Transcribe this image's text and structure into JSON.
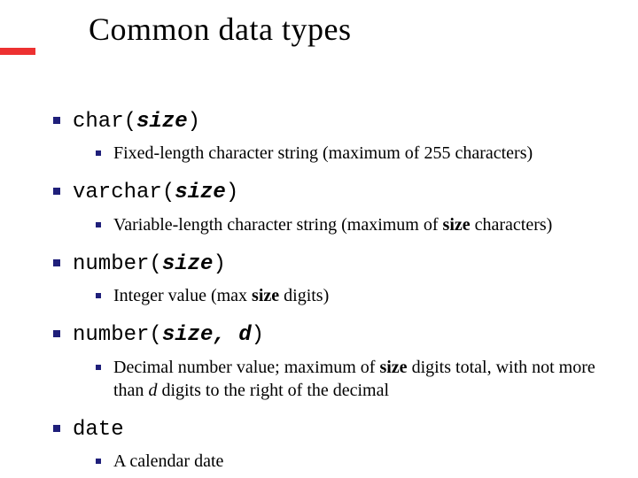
{
  "title": "Common data types",
  "items": [
    {
      "type_prefix": "char(",
      "type_param": "size",
      "type_suffix": ")",
      "sub": [
        {
          "segments": [
            {
              "t": "Fixed-length character string (maximum of 255 characters)"
            }
          ]
        }
      ]
    },
    {
      "type_prefix": "varchar(",
      "type_param": "size",
      "type_suffix": ")",
      "sub": [
        {
          "segments": [
            {
              "t": "Variable-length character string (maximum of "
            },
            {
              "t": "size",
              "bold": true
            },
            {
              "t": " characters)"
            }
          ]
        }
      ]
    },
    {
      "type_prefix": "number(",
      "type_param": "size",
      "type_suffix": ")",
      "sub": [
        {
          "segments": [
            {
              "t": "Integer value (max "
            },
            {
              "t": "size",
              "bold": true
            },
            {
              "t": " digits)"
            }
          ]
        }
      ]
    },
    {
      "type_prefix": "number(",
      "type_param": "size, d",
      "type_suffix": ")",
      "sub": [
        {
          "segments": [
            {
              "t": "Decimal number value; maximum of "
            },
            {
              "t": "size",
              "bold": true
            },
            {
              "t": " digits total, with not more than "
            },
            {
              "t": "d",
              "ital": true
            },
            {
              "t": " digits to the right of the decimal"
            }
          ]
        }
      ]
    },
    {
      "type_prefix": "date",
      "type_param": "",
      "type_suffix": "",
      "sub": [
        {
          "segments": [
            {
              "t": "A calendar date"
            }
          ]
        }
      ]
    }
  ]
}
